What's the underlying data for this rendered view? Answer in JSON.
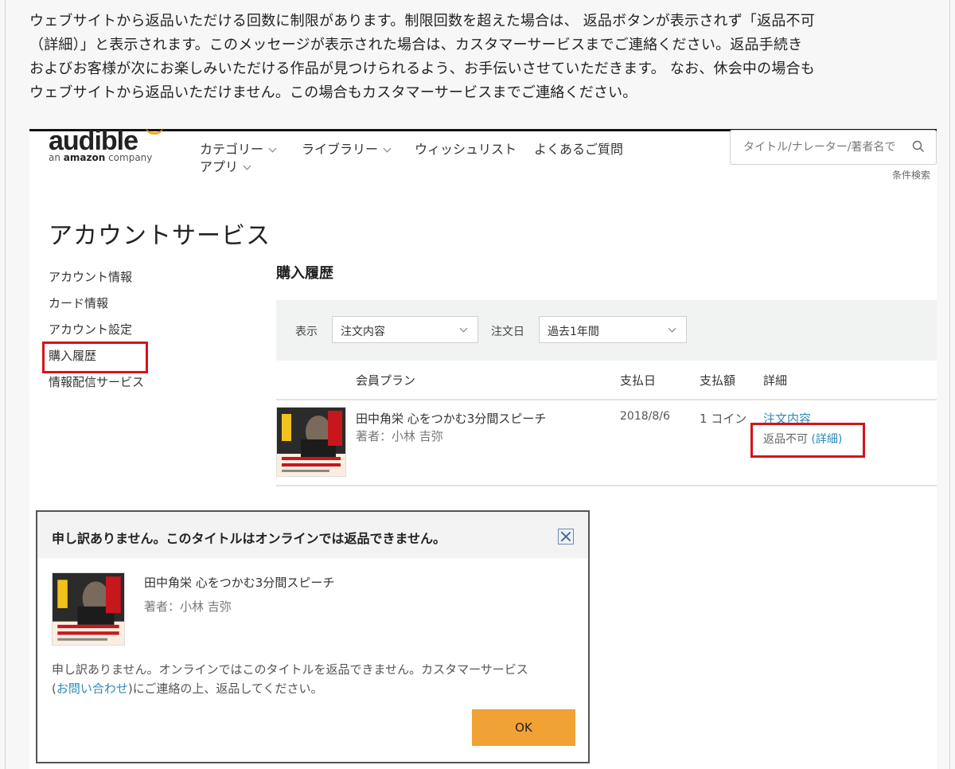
{
  "intro": {
    "line1": "ウェブサイトから返品いただける回数に制限があります。制限回数を超えた場合は、 返品ボタンが表示されず「返品不可",
    "line2": "（詳細）」と表示されます。このメッセージが表示された場合は、カスタマーサービスまでご連絡ください。返品手続き",
    "line3": "およびお客様が次にお楽しみいただける作品が見つけられるよう、お手伝いさせていただきます。 なお、休会中の場合も",
    "line4": "ウェブサイトから返品いただけません。この場合もカスタマーサービスまでご連絡ください。"
  },
  "header": {
    "logo_word": "audible",
    "logo_sub_pre": "an ",
    "logo_sub_brand": "amazon",
    "logo_sub_post": " company",
    "nav": {
      "category": "カテゴリー",
      "library": "ライブラリー",
      "wishlist": "ウィッシュリスト",
      "faq": "よくあるご質問",
      "apps": "アプリ"
    },
    "search_placeholder": "タイトル/ナレーター/著者名で",
    "advanced_search": "条件検索"
  },
  "page_title": "アカウントサービス",
  "sidebar": {
    "items": [
      "アカウント情報",
      "カード情報",
      "アカウント設定",
      "購入履歴",
      "情報配信サービス"
    ]
  },
  "purchase_history": {
    "title": "購入履歴",
    "filter": {
      "show_label": "表示",
      "show_value": "注文内容",
      "date_label": "注文日",
      "date_value": "過去1年間"
    },
    "columns": {
      "plan": "会員プラン",
      "pay_date": "支払日",
      "amount": "支払額",
      "details": "詳細"
    },
    "row": {
      "title": "田中角栄 心をつかむ3分間スピーチ",
      "author": "著者：小林 吉弥",
      "pay_date": "2018/8/6",
      "amount": "1 コイン",
      "order_link": "注文内容",
      "return_status": "返品不可",
      "details_link": "詳細"
    }
  },
  "modal": {
    "title": "申し訳ありません。このタイトルはオンラインでは返品できません。",
    "book_title": "田中角栄 心をつかむ3分間スピーチ",
    "book_author": "著者：小林 吉弥",
    "msg_line1": "申し訳ありません。オンラインではこのタイトルを返品できません。カスタマーサービス",
    "msg_link": "お問い合わせ",
    "msg_line2_post": "にご連絡の上、返品してください。",
    "ok_label": "OK"
  },
  "colors": {
    "highlight": "#d6131a",
    "link": "#2b8ab8",
    "ok_button": "#f0a235",
    "logo_accent": "#f7a11b"
  },
  "icons": {
    "search": "search-icon",
    "close": "close-icon",
    "chevron": "chevron-down-icon"
  }
}
